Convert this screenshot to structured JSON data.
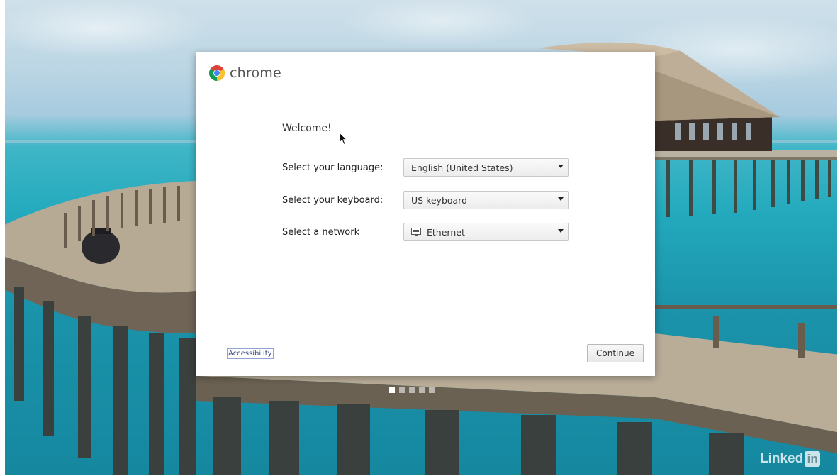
{
  "wallpaper": {
    "description_icon": "ocean-pier-wallpaper"
  },
  "dialog": {
    "brand": {
      "icon": "chrome-logo",
      "name": "chrome"
    },
    "welcome": "Welcome!",
    "language": {
      "label": "Select your language:",
      "value": "English (United States)"
    },
    "keyboard": {
      "label": "Select your keyboard:",
      "value": "US keyboard"
    },
    "network": {
      "label": "Select a network",
      "value": "Ethernet",
      "icon": "ethernet-icon"
    },
    "accessibility_label": "Accessibility",
    "continue_label": "Continue"
  },
  "pagination": {
    "count": 5,
    "active": 0
  },
  "watermark": {
    "text": "Linked",
    "badge": "in"
  }
}
